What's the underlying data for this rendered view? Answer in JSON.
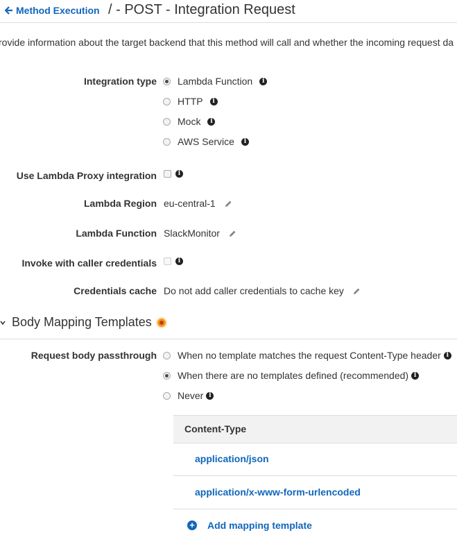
{
  "header": {
    "back_label": "Method Execution",
    "title": "/ - POST - Integration Request"
  },
  "description": "rovide information about the target backend that this method will call and whether the incoming request da",
  "integration_type": {
    "label": "Integration type",
    "options": [
      {
        "label": "Lambda Function",
        "selected": true
      },
      {
        "label": "HTTP",
        "selected": false
      },
      {
        "label": "Mock",
        "selected": false
      },
      {
        "label": "AWS Service",
        "selected": false
      }
    ]
  },
  "proxy": {
    "label": "Use Lambda Proxy integration"
  },
  "region": {
    "label": "Lambda Region",
    "value": "eu-central-1"
  },
  "function": {
    "label": "Lambda Function",
    "value": "SlackMonitor"
  },
  "caller_credentials": {
    "label": "Invoke with caller credentials"
  },
  "credentials_cache": {
    "label": "Credentials cache",
    "value": "Do not add caller credentials to cache key"
  },
  "body_mapping": {
    "title": "Body Mapping Templates",
    "passthrough_label": "Request body passthrough",
    "options": [
      {
        "label": "When no template matches the request Content-Type header",
        "selected": false
      },
      {
        "label": "When there are no templates defined (recommended)",
        "selected": true
      },
      {
        "label": "Never",
        "selected": false
      }
    ],
    "table_header": "Content-Type",
    "content_types": [
      "application/json",
      "application/x-www-form-urlencoded"
    ],
    "add_label": "Add mapping template"
  },
  "colors": {
    "link": "#1166bb",
    "accent_orange": "#f39c12"
  }
}
